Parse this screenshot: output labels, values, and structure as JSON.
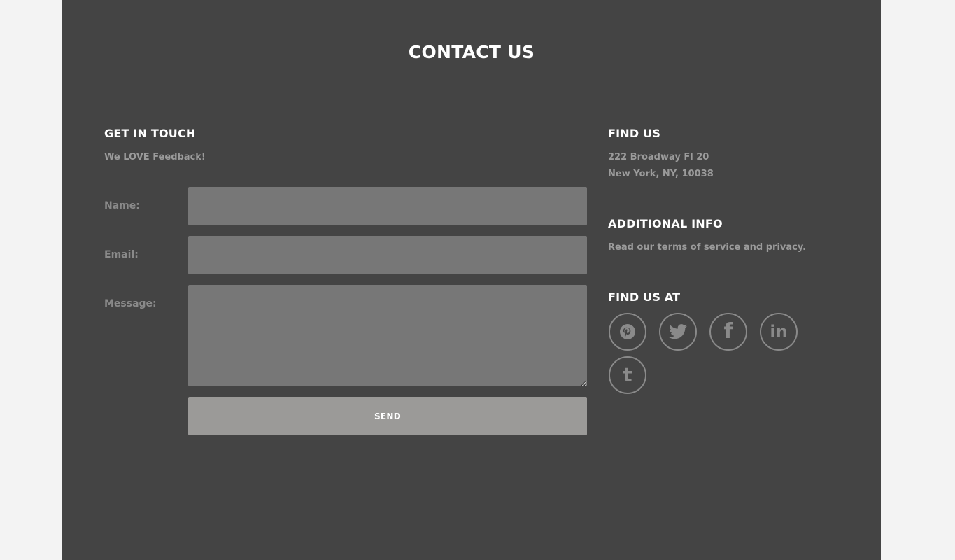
{
  "page": {
    "title": "CONTACT US"
  },
  "get_in_touch": {
    "heading": "GET IN TOUCH",
    "subtitle": "We LOVE Feedback!"
  },
  "form": {
    "name_label": "Name:",
    "name_value": "",
    "email_label": "Email:",
    "email_value": "",
    "message_label": "Message:",
    "message_value": "",
    "send_label": "SEND"
  },
  "find_us": {
    "heading": "FIND US",
    "address_line1": "222 Broadway Fl 20",
    "address_line2": "New York, NY, 10038"
  },
  "additional_info": {
    "heading": "ADDITIONAL INFO",
    "text": "Read our terms of service and privacy."
  },
  "find_us_at": {
    "heading": "FIND US AT",
    "icons": [
      "pinterest-icon",
      "twitter-icon",
      "facebook-icon",
      "linkedin-icon",
      "tumblr-icon"
    ],
    "facebook_glyph": "f",
    "linkedin_glyph": "in",
    "tumblr_glyph": "t"
  },
  "colors": {
    "page_background": "#f3f3f3",
    "panel_background": "#444444",
    "input_background": "#777777",
    "button_background": "#9b9a98",
    "heading_text": "#ffffff",
    "muted_text": "#9b9b9b",
    "icon_stroke": "#8a8a8a"
  }
}
